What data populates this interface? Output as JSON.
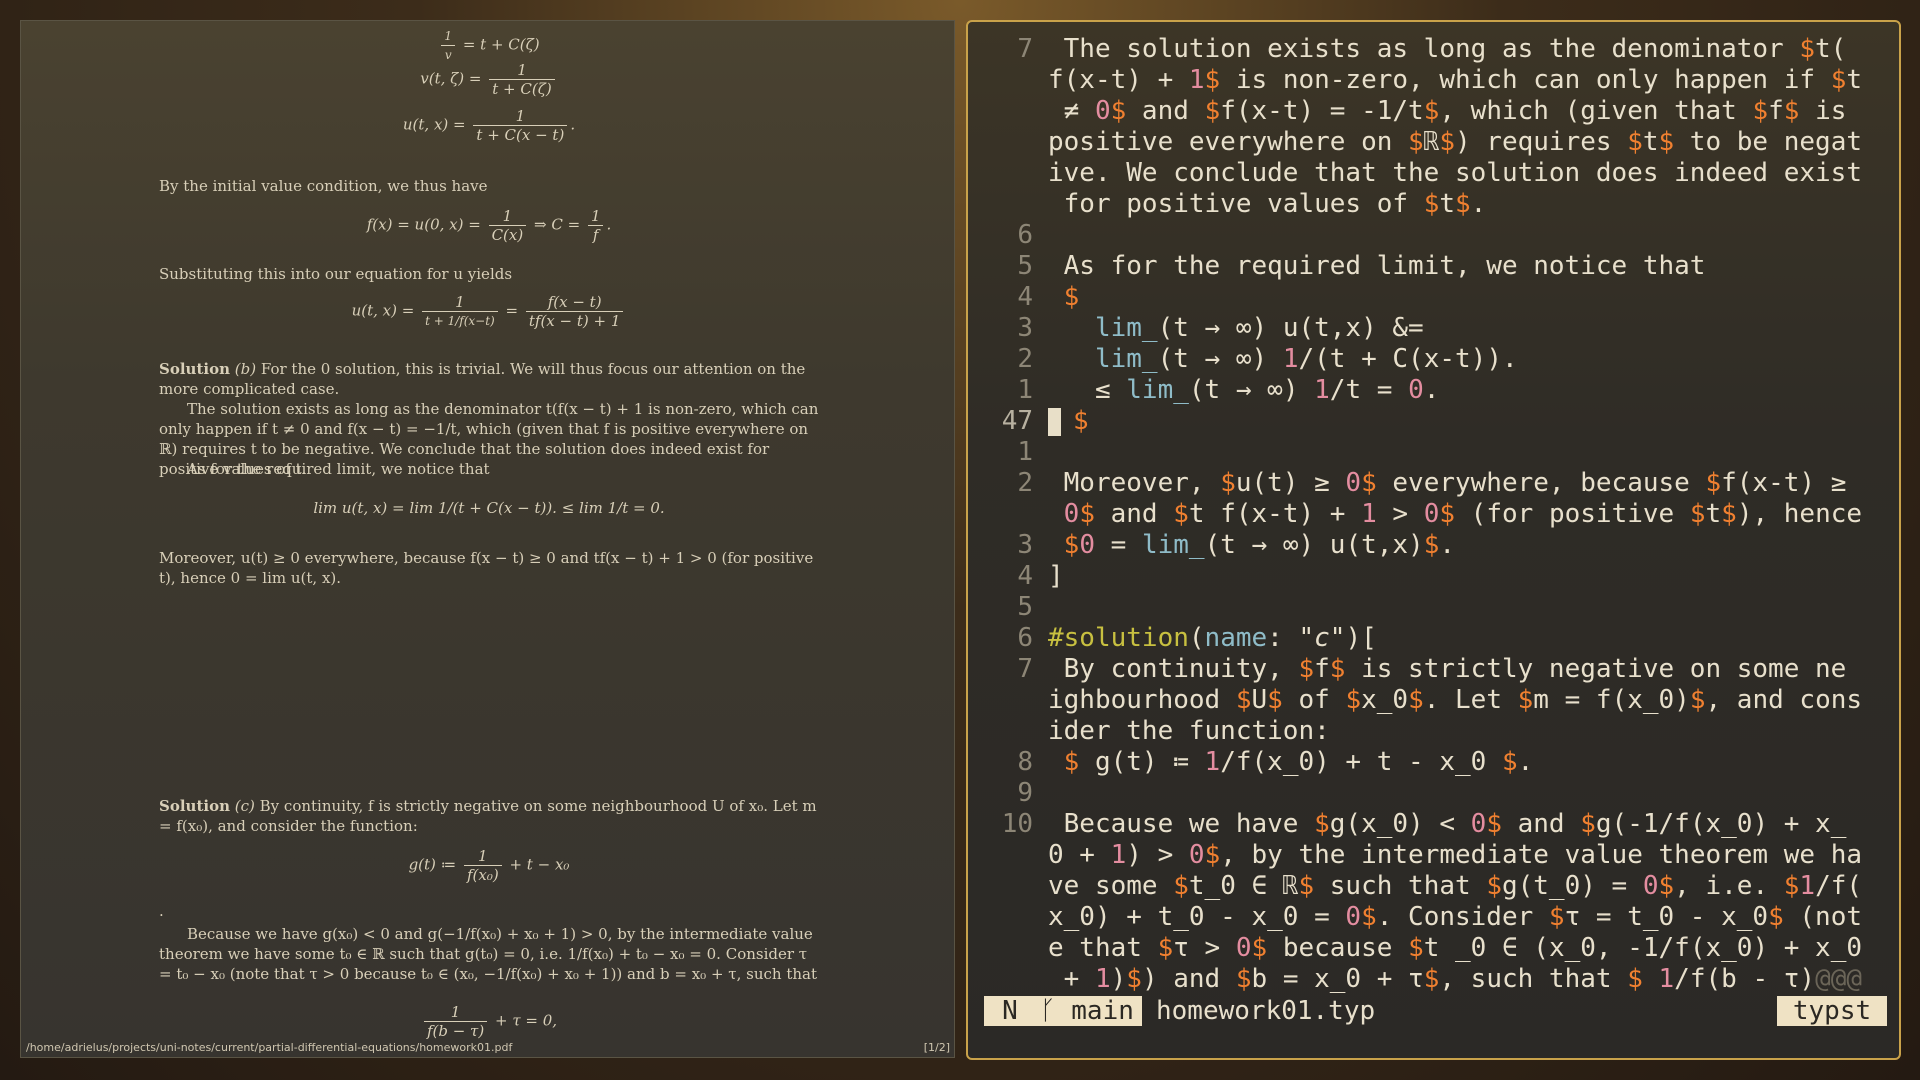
{
  "pdf": {
    "path": "/home/adrielus/projects/uni-notes/current/partial-differential-equations/homework01.pdf",
    "page_indicator": "[1/2]",
    "eq1": "1/v = t + C(ζ)",
    "eq2_lhs": "v(t, ζ) =",
    "eq2_num": "1",
    "eq2_den": "t + C(ζ)",
    "eq3_lhs": "u(t, x) =",
    "eq3_num": "1",
    "eq3_den": "t + C(x − t)",
    "initial_value_text": "By the initial value condition, we thus have",
    "eq4_lhs": "f(x) = u(0, x) =",
    "eq4_num": "1",
    "eq4_den": "C(x)",
    "eq4_mid": "⇒ C =",
    "eq4_num2": "1",
    "eq4_den2": "f",
    "substitute_text": "Substituting this into our equation for u yields",
    "eq5_lhs": "u(t, x) =",
    "eq5_num": "1",
    "eq5_den": "t + 1/f(x−t)",
    "eq5_eq": "=",
    "eq5_num2": "f(x − t)",
    "eq5_den2": "tf(x − t) + 1",
    "sol_b_head": "Solution",
    "sol_b_tag": "(b)",
    "sol_b_text": "For the 0 solution, this is trivial. We will thus focus our attention on the more complicated case.",
    "sol_b_para2": "The solution exists as long as the denominator t(f(x − t) + 1 is non-zero, which can only happen if t ≠ 0 and f(x − t) = −1/t, which (given that f is positive everywhere on ℝ) requires t to be negative. We conclude that the solution does indeed exist for positive values of t.",
    "limit_text": "As for the required limit, we notice that",
    "eq6": "lim u(t, x) = lim 1/(t + C(x − t)). ≤ lim 1/t = 0.",
    "moreover_text": "Moreover, u(t) ≥ 0 everywhere, because f(x − t) ≥ 0 and tf(x − t) + 1 > 0 (for positive t), hence 0 = lim u(t, x).",
    "sol_c_head": "Solution",
    "sol_c_tag": "(c)",
    "sol_c_text": "By continuity, f is strictly negative on some neighbourhood U of x₀. Let m = f(x₀), and consider the function:",
    "eq7_lhs": "g(t) ≔",
    "eq7_num": "1",
    "eq7_den": "f(x₀)",
    "eq7_rhs": "+ t − x₀",
    "dot": ".",
    "because_text": "Because we have g(x₀) < 0 and g(−1/f(x₀) + x₀ + 1) > 0, by the intermediate value theorem we have some t₀ ∈ ℝ such that g(t₀) = 0, i.e. 1/f(x₀) + t₀ − x₀ = 0. Consider τ = t₀ − x₀ (note that τ > 0 because t₀ ∈ (x₀, −1/f(x₀) + x₀ + 1)) and b = x₀ + τ, such that",
    "eq8_num": "1",
    "eq8_den": "f(b − τ)",
    "eq8_rhs": "+ τ = 0,"
  },
  "editor": {
    "lines": [
      {
        "num": "7",
        "tokens": [
          [
            "",
            " The solution exists as long as the denominator "
          ],
          [
            "o",
            "$"
          ],
          [
            "",
            "t("
          ]
        ]
      },
      {
        "num": "",
        "tokens": [
          [
            "",
            "f(x-t) + "
          ],
          [
            "p",
            "1"
          ],
          [
            "o",
            "$"
          ],
          [
            "",
            " is non-zero, which can only happen if "
          ],
          [
            "o",
            "$"
          ],
          [
            "",
            "t"
          ]
        ]
      },
      {
        "num": "",
        "tokens": [
          [
            "",
            " ≠ "
          ],
          [
            "p",
            "0"
          ],
          [
            "o",
            "$"
          ],
          [
            "",
            " and "
          ],
          [
            "o",
            "$"
          ],
          [
            "",
            "f(x-t) = -1/t"
          ],
          [
            "o",
            "$"
          ],
          [
            "",
            ", which (given that "
          ],
          [
            "o",
            "$"
          ],
          [
            "",
            "f"
          ],
          [
            "o",
            "$"
          ],
          [
            "",
            " is"
          ]
        ]
      },
      {
        "num": "",
        "tokens": [
          [
            "",
            "positive everywhere on "
          ],
          [
            "o",
            "$"
          ],
          [
            "",
            "ℝ"
          ],
          [
            "o",
            "$"
          ],
          [
            "",
            ") requires "
          ],
          [
            "o",
            "$"
          ],
          [
            "",
            "t"
          ],
          [
            "o",
            "$"
          ],
          [
            "",
            " to be negat"
          ]
        ]
      },
      {
        "num": "",
        "tokens": [
          [
            "",
            "ive. We conclude that the solution does indeed exist"
          ]
        ]
      },
      {
        "num": "",
        "tokens": [
          [
            "",
            " for positive values of "
          ],
          [
            "o",
            "$"
          ],
          [
            "",
            "t"
          ],
          [
            "o",
            "$"
          ],
          [
            "",
            "."
          ]
        ]
      },
      {
        "num": "6",
        "tokens": []
      },
      {
        "num": "5",
        "tokens": [
          [
            "",
            " As for the required limit, we notice that"
          ]
        ]
      },
      {
        "num": "4",
        "tokens": [
          [
            "o",
            " $"
          ]
        ]
      },
      {
        "num": "3",
        "tokens": [
          [
            "",
            "   "
          ],
          [
            "t",
            "lim_"
          ],
          [
            "",
            "(t → ∞) u(t,x) &="
          ]
        ]
      },
      {
        "num": "2",
        "tokens": [
          [
            "",
            "   "
          ],
          [
            "t",
            "lim_"
          ],
          [
            "",
            "(t → ∞) "
          ],
          [
            "p",
            "1"
          ],
          [
            "",
            "/(t + C(x-t))."
          ]
        ]
      },
      {
        "num": "1",
        "tokens": [
          [
            "",
            "   ≤ "
          ],
          [
            "t",
            "lim_"
          ],
          [
            "",
            "(t → ∞) "
          ],
          [
            "p",
            "1"
          ],
          [
            "",
            "/t = "
          ],
          [
            "p",
            "0"
          ],
          [
            "",
            "."
          ]
        ]
      },
      {
        "num": "47",
        "cursor": true,
        "tokens": [
          [
            "o",
            "$"
          ]
        ]
      },
      {
        "num": "1",
        "tokens": []
      },
      {
        "num": "2",
        "tokens": [
          [
            "",
            " Moreover, "
          ],
          [
            "o",
            "$"
          ],
          [
            "",
            "u(t) ≥ "
          ],
          [
            "p",
            "0"
          ],
          [
            "o",
            "$"
          ],
          [
            "",
            " everywhere, because "
          ],
          [
            "o",
            "$"
          ],
          [
            "",
            "f(x-t) ≥"
          ]
        ]
      },
      {
        "num": "",
        "tokens": [
          [
            "",
            " "
          ],
          [
            "p",
            "0"
          ],
          [
            "o",
            "$"
          ],
          [
            "",
            " and "
          ],
          [
            "o",
            "$"
          ],
          [
            "",
            "t f(x-t) + "
          ],
          [
            "p",
            "1"
          ],
          [
            "",
            " > "
          ],
          [
            "p",
            "0"
          ],
          [
            "o",
            "$"
          ],
          [
            "",
            " (for positive "
          ],
          [
            "o",
            "$"
          ],
          [
            "",
            "t"
          ],
          [
            "o",
            "$"
          ],
          [
            "",
            "), hence"
          ]
        ]
      },
      {
        "num": "3",
        "tokens": [
          [
            "",
            " "
          ],
          [
            "o",
            "$"
          ],
          [
            "p",
            "0"
          ],
          [
            "",
            " = "
          ],
          [
            "t",
            "lim_"
          ],
          [
            "",
            "(t → ∞) u(t,x)"
          ],
          [
            "o",
            "$"
          ],
          [
            "",
            "."
          ]
        ]
      },
      {
        "num": "4",
        "tokens": [
          [
            "",
            "]"
          ]
        ]
      },
      {
        "num": "5",
        "tokens": []
      },
      {
        "num": "6",
        "tokens": [
          [
            "y",
            "#solution"
          ],
          [
            "",
            "("
          ],
          [
            "t",
            "name"
          ],
          [
            "",
            ": "
          ],
          [
            "s",
            "\"c\""
          ],
          [
            "",
            ")["
          ]
        ]
      },
      {
        "num": "7",
        "tokens": [
          [
            "",
            " By continuity, "
          ],
          [
            "o",
            "$"
          ],
          [
            "",
            "f"
          ],
          [
            "o",
            "$"
          ],
          [
            "",
            " is strictly negative on some ne"
          ]
        ]
      },
      {
        "num": "",
        "tokens": [
          [
            "",
            "ighbourhood "
          ],
          [
            "o",
            "$"
          ],
          [
            "",
            "U"
          ],
          [
            "o",
            "$"
          ],
          [
            "",
            " of "
          ],
          [
            "o",
            "$"
          ],
          [
            "",
            "x_0"
          ],
          [
            "o",
            "$"
          ],
          [
            "",
            ". Let "
          ],
          [
            "o",
            "$"
          ],
          [
            "",
            "m = f(x_0)"
          ],
          [
            "o",
            "$"
          ],
          [
            "",
            ", and cons"
          ]
        ]
      },
      {
        "num": "",
        "tokens": [
          [
            "",
            "ider the function:"
          ]
        ]
      },
      {
        "num": "8",
        "tokens": [
          [
            "",
            " "
          ],
          [
            "o",
            "$"
          ],
          [
            "",
            " g(t) ≔ "
          ],
          [
            "p",
            "1"
          ],
          [
            "",
            "/f(x_0) + t - x_0 "
          ],
          [
            "o",
            "$"
          ],
          [
            "",
            "."
          ]
        ]
      },
      {
        "num": "9",
        "tokens": []
      },
      {
        "num": "10",
        "tokens": [
          [
            "",
            " Because we have "
          ],
          [
            "o",
            "$"
          ],
          [
            "",
            "g(x_0) < "
          ],
          [
            "p",
            "0"
          ],
          [
            "o",
            "$"
          ],
          [
            "",
            " and "
          ],
          [
            "o",
            "$"
          ],
          [
            "",
            "g(-1/f(x_0) + x_"
          ]
        ]
      },
      {
        "num": "",
        "tokens": [
          [
            "",
            "0 + "
          ],
          [
            "p",
            "1"
          ],
          [
            "",
            ") > "
          ],
          [
            "p",
            "0"
          ],
          [
            "o",
            "$"
          ],
          [
            "",
            ", by the intermediate value theorem we ha"
          ]
        ]
      },
      {
        "num": "",
        "tokens": [
          [
            "",
            "ve some "
          ],
          [
            "o",
            "$"
          ],
          [
            "",
            "t_0 ∈ ℝ"
          ],
          [
            "o",
            "$"
          ],
          [
            "",
            " such that "
          ],
          [
            "o",
            "$"
          ],
          [
            "",
            "g(t_0) = "
          ],
          [
            "p",
            "0"
          ],
          [
            "o",
            "$"
          ],
          [
            "",
            ", i.e. "
          ],
          [
            "o",
            "$"
          ],
          [
            "p",
            "1"
          ],
          [
            "",
            "/f("
          ]
        ]
      },
      {
        "num": "",
        "tokens": [
          [
            "",
            "x_0) + t_0 - x_0 = "
          ],
          [
            "p",
            "0"
          ],
          [
            "o",
            "$"
          ],
          [
            "",
            ". Consider "
          ],
          [
            "o",
            "$"
          ],
          [
            "",
            "τ = t_0 - x_0"
          ],
          [
            "o",
            "$"
          ],
          [
            "",
            " (not"
          ]
        ]
      },
      {
        "num": "",
        "tokens": [
          [
            "",
            "e that "
          ],
          [
            "o",
            "$"
          ],
          [
            "",
            "τ > "
          ],
          [
            "p",
            "0"
          ],
          [
            "o",
            "$"
          ],
          [
            "",
            " because "
          ],
          [
            "o",
            "$"
          ],
          [
            "",
            "t _0 ∈ (x_0, -1/f(x_0) + x_0"
          ]
        ]
      },
      {
        "num": "",
        "tokens": [
          [
            "",
            " + "
          ],
          [
            "p",
            "1"
          ],
          [
            "",
            ")"
          ],
          [
            "o",
            "$"
          ],
          [
            "",
            ") and "
          ],
          [
            "o",
            "$"
          ],
          [
            "",
            "b = x_0 + τ"
          ],
          [
            "o",
            "$"
          ],
          [
            "",
            ", such that "
          ],
          [
            "o",
            "$"
          ],
          [
            "",
            " "
          ],
          [
            "p",
            "1"
          ],
          [
            "",
            "/f(b - τ)"
          ],
          [
            "dim",
            "@@@"
          ]
        ]
      }
    ],
    "statusline": {
      "mode": "N",
      "branch_icon": "git-branch-icon",
      "branch": "main",
      "filename": "homework01.typ",
      "filetype": "typst"
    }
  }
}
